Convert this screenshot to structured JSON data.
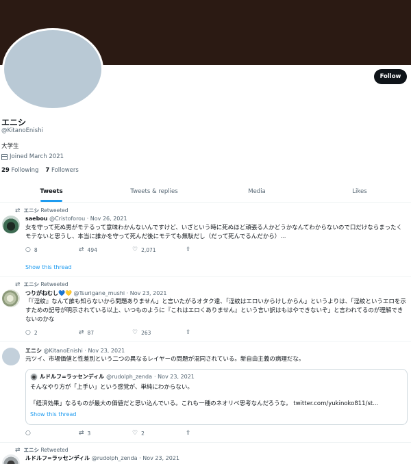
{
  "profile": {
    "name": "エニシ",
    "handle": "@KitanoEnishi",
    "bio": "大学生",
    "joined": "Joined March 2021",
    "following_count": "29",
    "following_label": "Following",
    "followers_count": "7",
    "followers_label": "Followers",
    "follow_label": "Follow"
  },
  "tabs": [
    "Tweets",
    "Tweets & replies",
    "Media",
    "Likes"
  ],
  "tweets": [
    {
      "retweeted_by": "エニシ",
      "retweet_label": "Retweeted",
      "author": "saebou",
      "handle": "@Cristoforou",
      "date": "· Nov 26, 2021",
      "text": "女を守って死ぬ男がモテるって意味わかんないんですけど、いざという時に死ぬほど頑張る人かどうかなんてわからないので口だけならまったくモテないと思うし、本当に誰かを守って死んだ後にモテても無駄だし（だって死んでるんだから）...",
      "replies": "8",
      "retweets": "494",
      "likes": "2,071",
      "show_thread": "Show this thread"
    },
    {
      "retweeted_by": "エニシ",
      "retweet_label": "Retweeted",
      "author": "つりがねむし💙💛",
      "handle": "@Tsurigane_mushi",
      "date": "· Nov 23, 2021",
      "text": "「『淫紋』なんて誰も知らないから問題ありません」と言いたがるオタク達、「淫紋はエロいからけしからん」というよりは、「淫紋というエロを示すための記号が明示されている以上、いつものように『これはエロくありません』という言い訳はもはやできないぞ」と言われてるのが理解できないのかな",
      "replies": "2",
      "retweets": "87",
      "likes": "263"
    },
    {
      "author": "エニシ",
      "handle": "@KitanoEnishi",
      "date": "· Nov 23, 2021",
      "text": "元ツイ、市場価値と性差別という二つの異なるレイヤーの問題が混同されている。新自由主義の病理だな。",
      "quote": {
        "author": "ルドルフ=ラッセンディル",
        "handle": "@rudolph_zenda",
        "date": "· Nov 23, 2021",
        "line1": "そんなやり方が「上手い」という感覚が、単純にわからない。",
        "line2": "「経済効果」なるものが最大の価値だと思い込んでいる。これも一種のネオリベ思考なんだろうな。 twitter.com/yukinoko811/st...",
        "show_thread": "Show this thread"
      },
      "replies": "",
      "retweets": "3",
      "likes": "2"
    },
    {
      "retweeted_by": "エニシ",
      "retweet_label": "Retweeted",
      "author": "ルドルフ=ラッセンディル",
      "handle": "@rudolph_zenda",
      "date": "· Nov 23, 2021"
    }
  ],
  "colors": {
    "banner": "#2b1a13",
    "accent": "#1d9bf0",
    "avatar_placeholder": "#b9c9d5"
  }
}
